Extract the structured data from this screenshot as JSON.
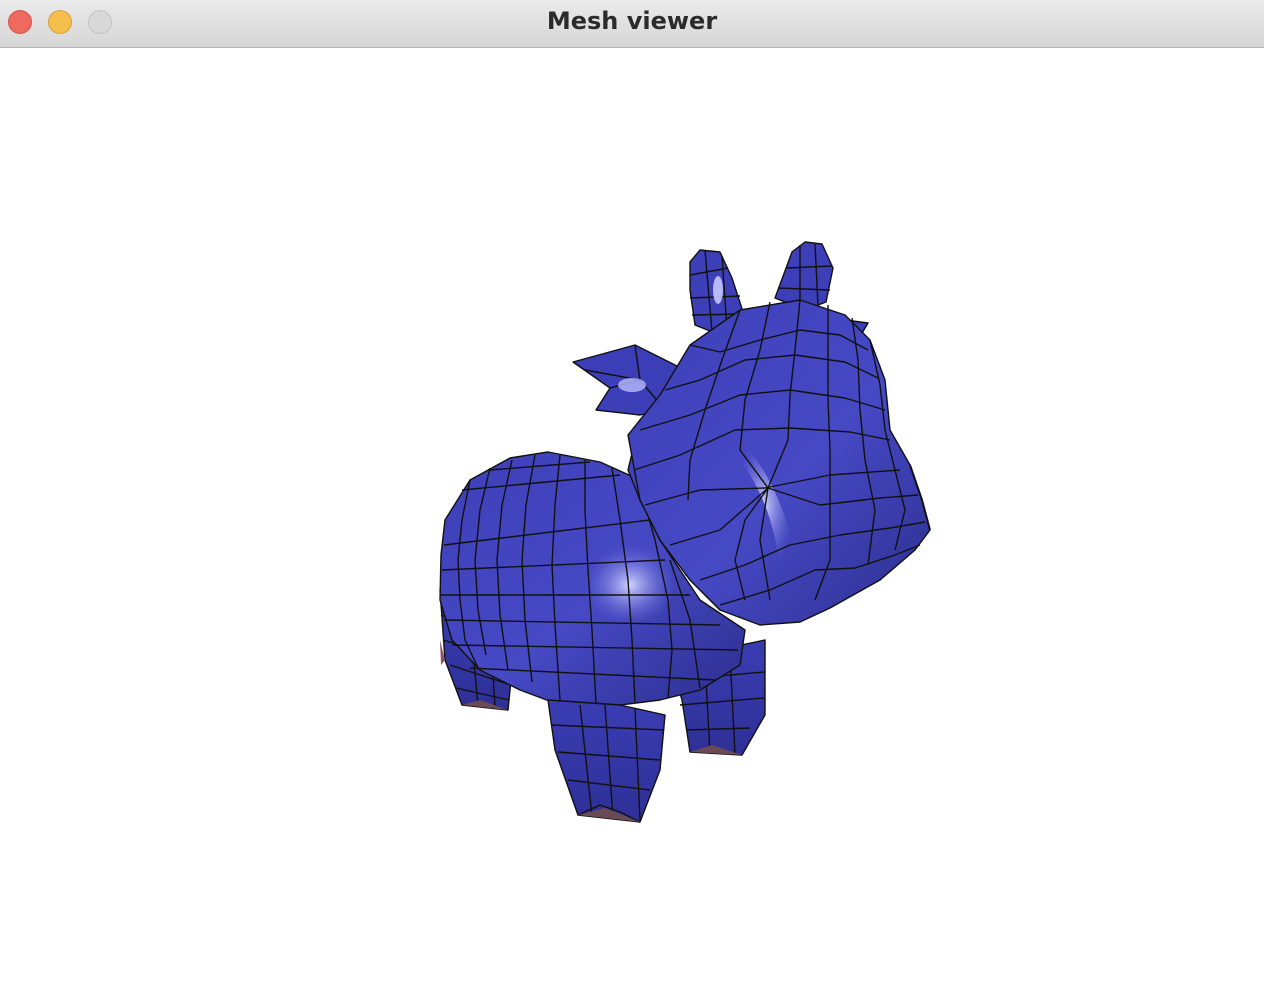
{
  "window": {
    "title": "Mesh viewer",
    "buttons": {
      "close": "close",
      "minimize": "minimize",
      "zoom": "zoom"
    }
  },
  "viewport": {
    "background": "#ffffff",
    "model": {
      "color": "#3a3db3",
      "edge_color": "#111111",
      "highlight_color": "#c8cbff"
    }
  }
}
